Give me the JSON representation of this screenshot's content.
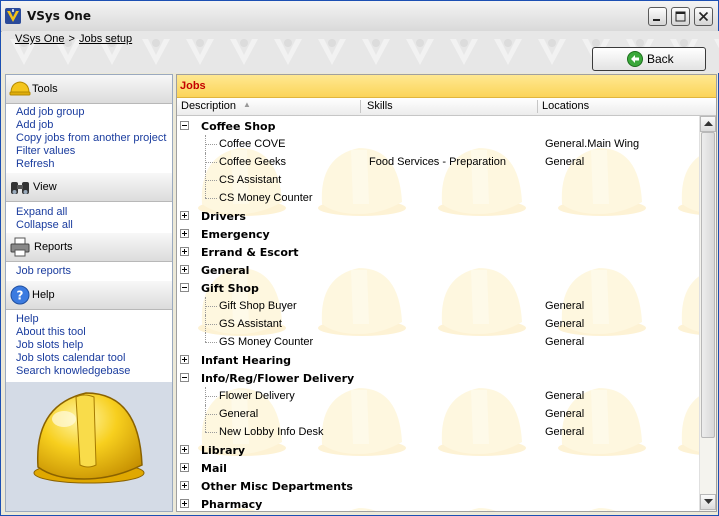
{
  "window": {
    "title": "VSys One"
  },
  "breadcrumb": {
    "root": "VSys One",
    "separator": ">",
    "current": "Jobs setup"
  },
  "toolbar": {
    "back_label": "Back"
  },
  "sidebar": {
    "tools": {
      "label": "Tools",
      "links": [
        "Add job group",
        "Add job",
        "Copy jobs from another project",
        "Filter values",
        "Refresh"
      ]
    },
    "view": {
      "label": "View",
      "links": [
        "Expand all",
        "Collapse all"
      ]
    },
    "reports": {
      "label": "Reports",
      "links": [
        "Job reports"
      ]
    },
    "help": {
      "label": "Help",
      "links": [
        "Help",
        "About this tool",
        "Job slots help",
        "Job slots calendar tool",
        "Search knowledgebase"
      ]
    }
  },
  "jobs_panel": {
    "title": "Jobs",
    "columns": {
      "description": "Description",
      "skills": "Skills",
      "locations": "Locations"
    },
    "rows": [
      {
        "type": "group",
        "name": "Coffee Shop",
        "expanded": true
      },
      {
        "type": "job",
        "name": "Coffee COVE",
        "skills": "",
        "location": "General.Main Wing"
      },
      {
        "type": "job",
        "name": "Coffee Geeks",
        "skills": "Food Services - Preparation",
        "location": "General"
      },
      {
        "type": "job",
        "name": "CS Assistant",
        "skills": "",
        "location": ""
      },
      {
        "type": "job",
        "name": "CS Money Counter",
        "skills": "",
        "location": "",
        "last": true
      },
      {
        "type": "group",
        "name": "Drivers",
        "expanded": false
      },
      {
        "type": "group",
        "name": "Emergency",
        "expanded": false
      },
      {
        "type": "group",
        "name": "Errand & Escort",
        "expanded": false
      },
      {
        "type": "group",
        "name": "General",
        "expanded": false
      },
      {
        "type": "group",
        "name": "Gift Shop",
        "expanded": true
      },
      {
        "type": "job",
        "name": "Gift Shop Buyer",
        "skills": "",
        "location": "General"
      },
      {
        "type": "job",
        "name": "GS Assistant",
        "skills": "",
        "location": "General"
      },
      {
        "type": "job",
        "name": "GS Money Counter",
        "skills": "",
        "location": "General",
        "last": true
      },
      {
        "type": "group",
        "name": "Infant Hearing",
        "expanded": false
      },
      {
        "type": "group",
        "name": "Info/Reg/Flower Delivery",
        "expanded": true
      },
      {
        "type": "job",
        "name": "Flower Delivery",
        "skills": "",
        "location": "General"
      },
      {
        "type": "job",
        "name": "General",
        "skills": "",
        "location": "General"
      },
      {
        "type": "job",
        "name": "New Lobby Info Desk",
        "skills": "",
        "location": "General",
        "last": true
      },
      {
        "type": "group",
        "name": "Library",
        "expanded": false
      },
      {
        "type": "group",
        "name": "Mail",
        "expanded": false
      },
      {
        "type": "group",
        "name": "Other Misc Departments",
        "expanded": false
      },
      {
        "type": "group",
        "name": "Pharmacy",
        "expanded": false
      }
    ]
  },
  "colors": {
    "jobs_title": "#c40000",
    "link": "#1a3c9e",
    "header_yellow": "#fbd459"
  }
}
